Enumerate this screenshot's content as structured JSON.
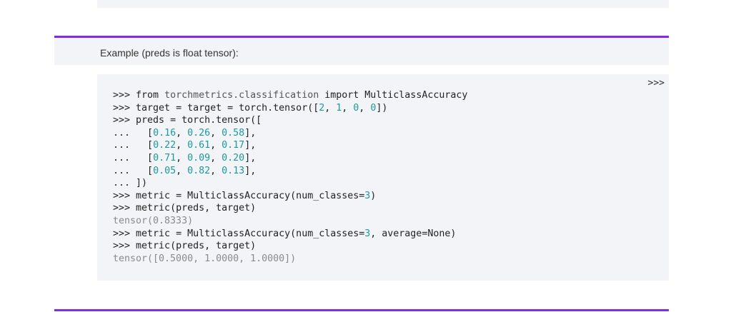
{
  "example": {
    "title": "Example (preds is float tensor):"
  },
  "code": {
    "copy_toggle": ">>>",
    "lines": [
      [
        {
          "t": "prompt",
          "v": ">>> "
        },
        {
          "t": "kw",
          "v": "from "
        },
        {
          "t": "mod",
          "v": "torchmetrics.classification"
        },
        {
          "t": "kw",
          "v": " import "
        },
        {
          "t": "plain",
          "v": "MulticlassAccuracy"
        }
      ],
      [
        {
          "t": "prompt",
          "v": ">>> "
        },
        {
          "t": "plain",
          "v": "target = target = torch.tensor(["
        },
        {
          "t": "num",
          "v": "2"
        },
        {
          "t": "plain",
          "v": ", "
        },
        {
          "t": "num",
          "v": "1"
        },
        {
          "t": "plain",
          "v": ", "
        },
        {
          "t": "num",
          "v": "0"
        },
        {
          "t": "plain",
          "v": ", "
        },
        {
          "t": "num",
          "v": "0"
        },
        {
          "t": "plain",
          "v": "])"
        }
      ],
      [
        {
          "t": "prompt",
          "v": ">>> "
        },
        {
          "t": "plain",
          "v": "preds = torch.tensor(["
        }
      ],
      [
        {
          "t": "prompt",
          "v": "...   "
        },
        {
          "t": "plain",
          "v": "["
        },
        {
          "t": "num",
          "v": "0.16"
        },
        {
          "t": "plain",
          "v": ", "
        },
        {
          "t": "num",
          "v": "0.26"
        },
        {
          "t": "plain",
          "v": ", "
        },
        {
          "t": "num",
          "v": "0.58"
        },
        {
          "t": "plain",
          "v": "],"
        }
      ],
      [
        {
          "t": "prompt",
          "v": "...   "
        },
        {
          "t": "plain",
          "v": "["
        },
        {
          "t": "num",
          "v": "0.22"
        },
        {
          "t": "plain",
          "v": ", "
        },
        {
          "t": "num",
          "v": "0.61"
        },
        {
          "t": "plain",
          "v": ", "
        },
        {
          "t": "num",
          "v": "0.17"
        },
        {
          "t": "plain",
          "v": "],"
        }
      ],
      [
        {
          "t": "prompt",
          "v": "...   "
        },
        {
          "t": "plain",
          "v": "["
        },
        {
          "t": "num",
          "v": "0.71"
        },
        {
          "t": "plain",
          "v": ", "
        },
        {
          "t": "num",
          "v": "0.09"
        },
        {
          "t": "plain",
          "v": ", "
        },
        {
          "t": "num",
          "v": "0.20"
        },
        {
          "t": "plain",
          "v": "],"
        }
      ],
      [
        {
          "t": "prompt",
          "v": "...   "
        },
        {
          "t": "plain",
          "v": "["
        },
        {
          "t": "num",
          "v": "0.05"
        },
        {
          "t": "plain",
          "v": ", "
        },
        {
          "t": "num",
          "v": "0.82"
        },
        {
          "t": "plain",
          "v": ", "
        },
        {
          "t": "num",
          "v": "0.13"
        },
        {
          "t": "plain",
          "v": "],"
        }
      ],
      [
        {
          "t": "prompt",
          "v": "... "
        },
        {
          "t": "plain",
          "v": "])"
        }
      ],
      [
        {
          "t": "prompt",
          "v": ">>> "
        },
        {
          "t": "plain",
          "v": "metric = MulticlassAccuracy(num_classes="
        },
        {
          "t": "num",
          "v": "3"
        },
        {
          "t": "plain",
          "v": ")"
        }
      ],
      [
        {
          "t": "prompt",
          "v": ">>> "
        },
        {
          "t": "plain",
          "v": "metric(preds, target)"
        }
      ],
      [
        {
          "t": "out",
          "v": "tensor(0.8333)"
        }
      ],
      [
        {
          "t": "prompt",
          "v": ">>> "
        },
        {
          "t": "plain",
          "v": "metric = MulticlassAccuracy(num_classes="
        },
        {
          "t": "num",
          "v": "3"
        },
        {
          "t": "plain",
          "v": ", average=None)"
        }
      ],
      [
        {
          "t": "prompt",
          "v": ">>> "
        },
        {
          "t": "plain",
          "v": "metric(preds, target)"
        }
      ],
      [
        {
          "t": "out",
          "v": "tensor([0.5000, 1.0000, 1.0000])"
        }
      ]
    ]
  },
  "colors": {
    "accent": "#812ce5",
    "panel_bg": "#f3f4f7",
    "number": "#1a9a9a",
    "output": "#8a8a8a"
  }
}
